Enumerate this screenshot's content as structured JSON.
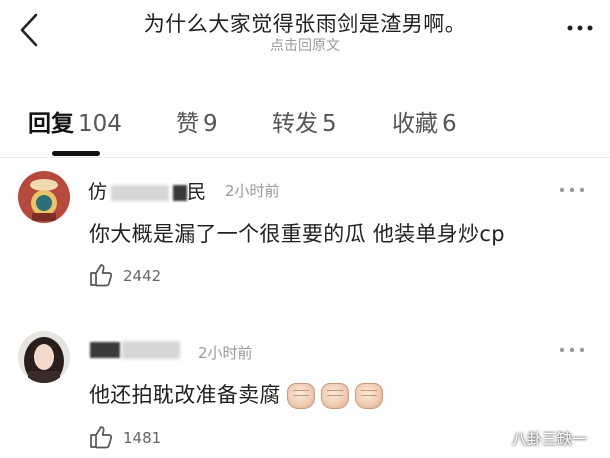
{
  "header": {
    "title": "为什么大家觉得张雨剑是渣男啊。",
    "subtitle": "点击回原文"
  },
  "tabs": [
    {
      "label": "回复",
      "count": "104",
      "active": true
    },
    {
      "label": "赞",
      "count": "9",
      "active": false
    },
    {
      "label": "转发",
      "count": "5",
      "active": false
    },
    {
      "label": "收藏",
      "count": "6",
      "active": false
    }
  ],
  "comments": [
    {
      "name_prefix": "仿",
      "name_suffix": "民",
      "time": "2小时前",
      "text": "你大概是漏了一个很重要的瓜 他装单身炒cp",
      "likes": "2442"
    },
    {
      "time": "2小时前",
      "text": "他还拍耽改准备卖腐",
      "likes": "1481",
      "emoji": "fist-emoji"
    }
  ],
  "watermark": "八卦三缺一"
}
